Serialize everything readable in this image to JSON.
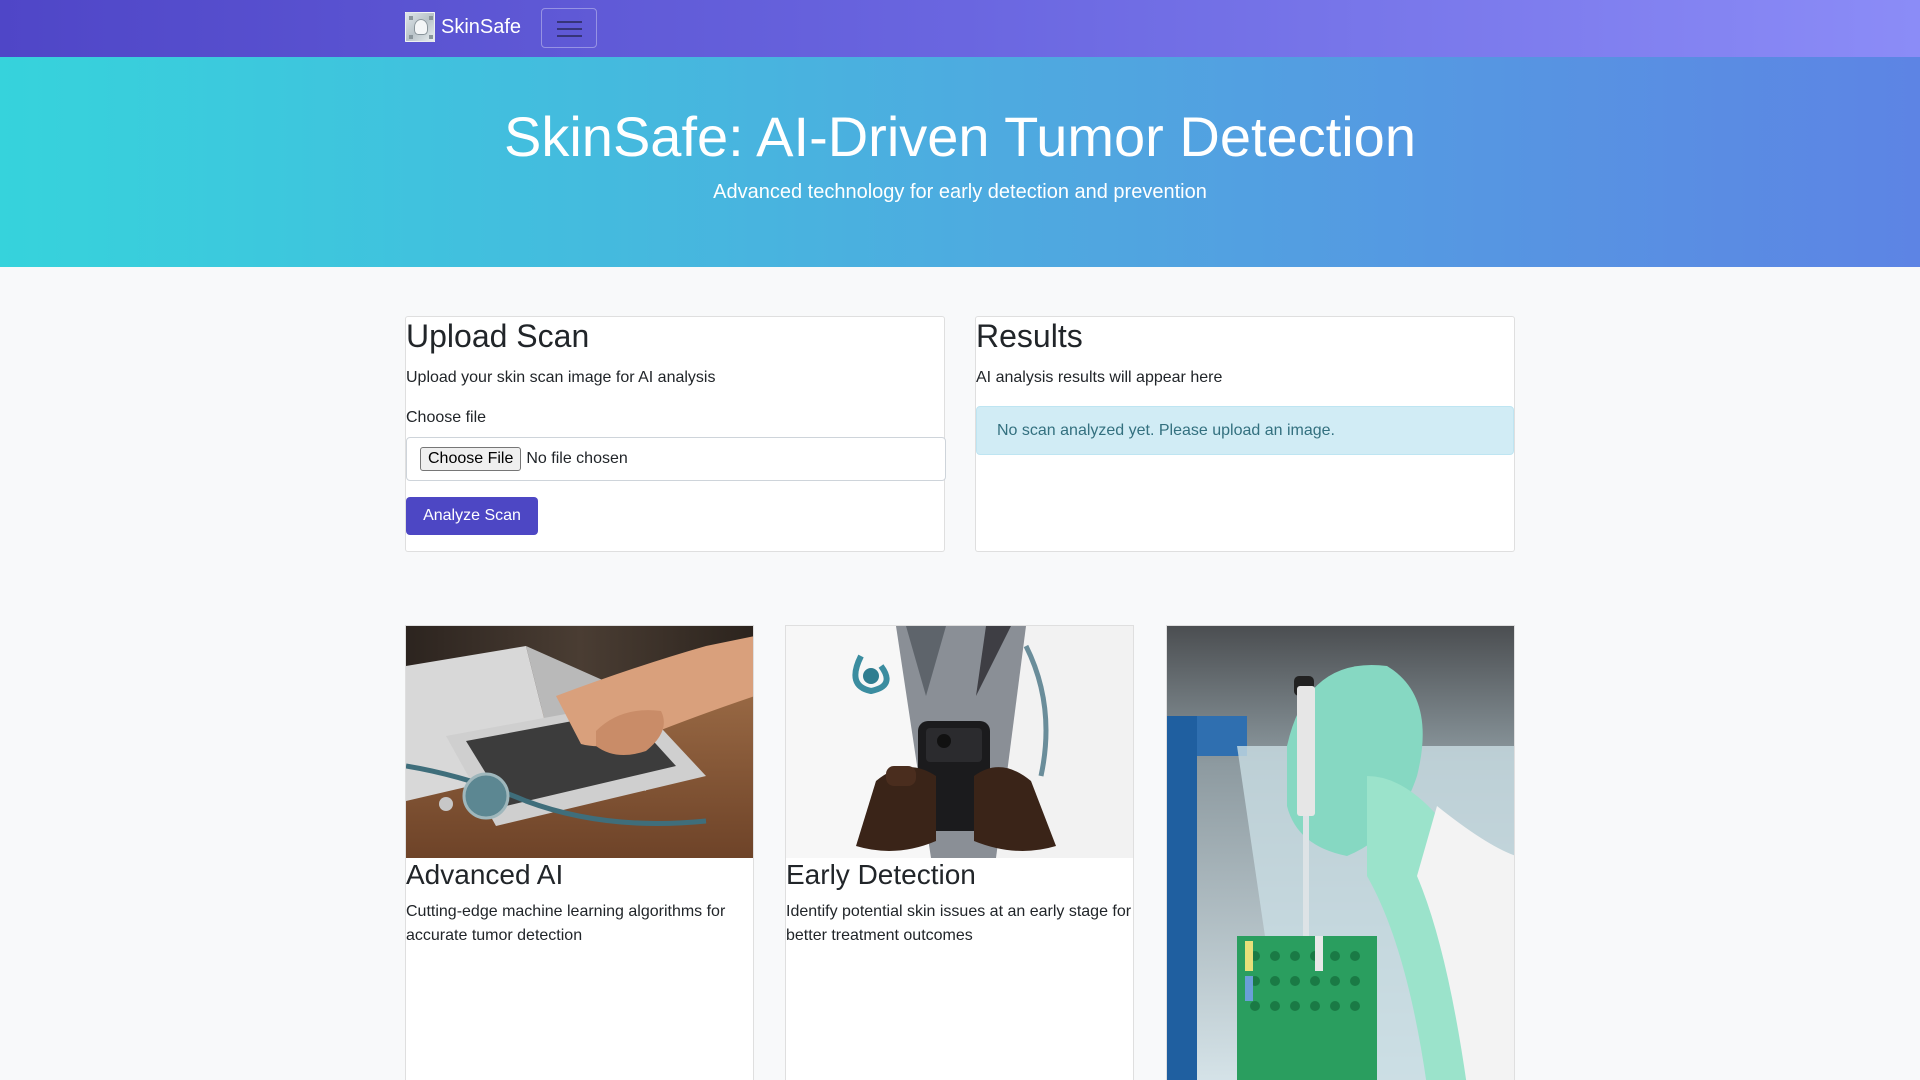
{
  "navbar": {
    "brand": "SkinSafe",
    "logo_icon": "skin-scan-logo-icon",
    "toggle_icon": "hamburger-menu-icon"
  },
  "hero": {
    "title": "SkinSafe: AI-Driven Tumor Detection",
    "subtitle": "Advanced technology for early detection and prevention"
  },
  "upload": {
    "title": "Upload Scan",
    "description": "Upload your skin scan image for AI analysis",
    "file_label": "Choose file",
    "file_button": "Choose File",
    "file_status": "No file chosen",
    "submit_label": "Analyze Scan"
  },
  "results": {
    "title": "Results",
    "description": "AI analysis results will appear here",
    "alert": "No scan analyzed yet. Please upload an image."
  },
  "features": [
    {
      "title": "Advanced AI",
      "description": "Cutting-edge machine learning algorithms for accurate tumor detection"
    },
    {
      "title": "Early Detection",
      "description": "Identify potential skin issues at an early stage for better treatment outcomes"
    },
    {
      "title": "",
      "description": ""
    }
  ],
  "colors": {
    "navbar_start": "#4f46c7",
    "navbar_end": "#8b8cf7",
    "hero_start": "#36d3dc",
    "hero_end": "#5d84e4",
    "primary_button": "#4d47c4",
    "alert_bg": "#d1ecf5"
  }
}
